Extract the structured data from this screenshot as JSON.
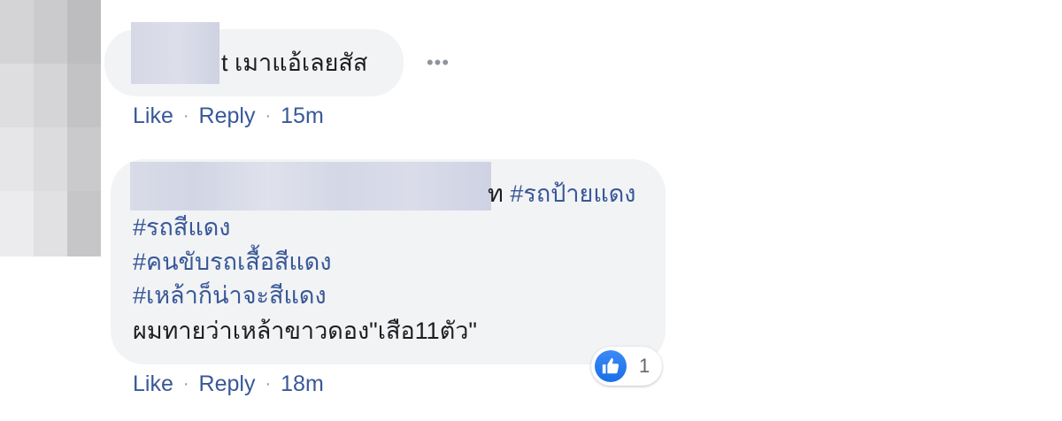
{
  "comments": [
    {
      "author_suffix": "t",
      "text": "เมาแอ้เลยสัส",
      "more_label": "•••",
      "like_label": "Like",
      "reply_label": "Reply",
      "separator": "·",
      "time": "15m"
    },
    {
      "author_tail": "ท",
      "lines": [
        {
          "text": "#รถป้ายแดง",
          "kind": "hashtag"
        },
        {
          "text": "#รถสีแดง",
          "kind": "hashtag"
        },
        {
          "text": "#คนขับรถเสื้อสีแดง",
          "kind": "hashtag"
        },
        {
          "text": "#เหล้าก็น่าจะสีแดง",
          "kind": "hashtag"
        },
        {
          "text": "ผมทายว่าเหล้าขาวดอง\"เสือ11ตัว\"",
          "kind": "plain"
        }
      ],
      "reaction_icon": "thumbs-up-icon",
      "reaction_count": "1",
      "like_label": "Like",
      "reply_label": "Reply",
      "separator": "·",
      "time": "18m"
    }
  ],
  "colors": {
    "link": "#385898",
    "bubble": "#f2f3f5",
    "text": "#1c1e21",
    "like_blue": "#1a6ee8"
  }
}
